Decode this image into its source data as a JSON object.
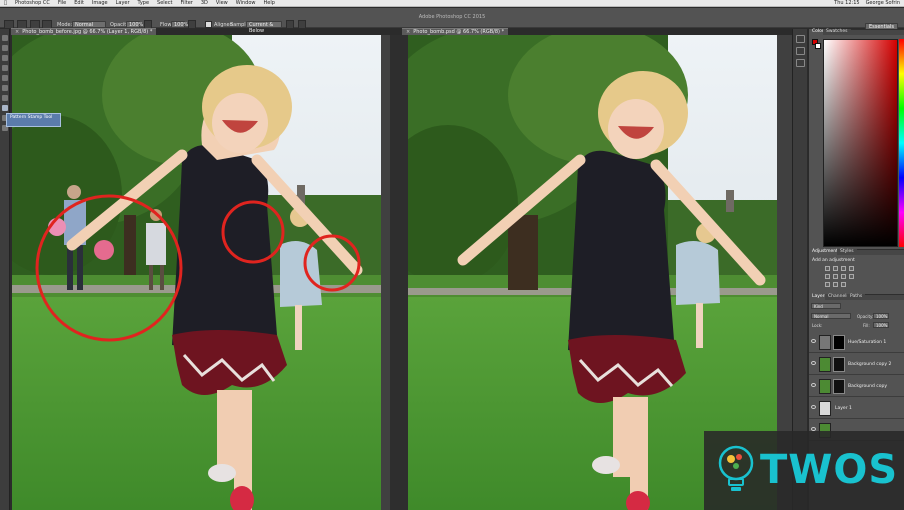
{
  "os_menubar": {
    "items": [
      "Photoshop CC",
      "File",
      "Edit",
      "Image",
      "Layer",
      "Type",
      "Select",
      "Filter",
      "3D",
      "View",
      "Window",
      "Help"
    ],
    "right_items": [
      "Thu 12:15",
      "George Sofrin"
    ]
  },
  "app": {
    "title": "Adobe Photoshop CC 2015",
    "workspace": "Essentials"
  },
  "options_bar": {
    "mode_label": "Mode:",
    "mode_value": "Normal",
    "opacity_label": "Opacity:",
    "opacity_value": "100%",
    "flow_label": "Flow:",
    "flow_value": "100%",
    "aligned_label": "Aligned",
    "sample_label": "Sample:",
    "sample_value": "Current & Below"
  },
  "documents": [
    {
      "tab": "Photo_bomb_before.jpg @ 66.7% (Layer 1, RGB/8) *"
    },
    {
      "tab": "Photo_bomb.psd @ 66.7% (RGB/8) *"
    }
  ],
  "tooltip": {
    "line1": "",
    "line2": "Pattern Stamp Tool"
  },
  "panels": {
    "color_tabs": [
      "Color",
      "Swatches"
    ],
    "adjustment_tabs": [
      "Adjustments",
      "Styles"
    ],
    "adjustment_label": "Add an adjustment",
    "layers_tabs": [
      "Layers",
      "Channels",
      "Paths"
    ],
    "layers_kind": "Kind",
    "blend_mode": "Normal",
    "opacity_label": "Opacity:",
    "opacity_value": "100%",
    "lock_label": "Lock:",
    "fill_label": "Fill:",
    "fill_value": "100%",
    "layers": [
      {
        "name": "Hue/Saturation 1"
      },
      {
        "name": "Background copy 2"
      },
      {
        "name": "Background copy"
      },
      {
        "name": "Layer 1"
      }
    ]
  },
  "watermark": {
    "text": "TWOS"
  },
  "colors": {
    "accent": "#19c2cf",
    "circle": "#e0241f",
    "foreground": "#d40000"
  }
}
